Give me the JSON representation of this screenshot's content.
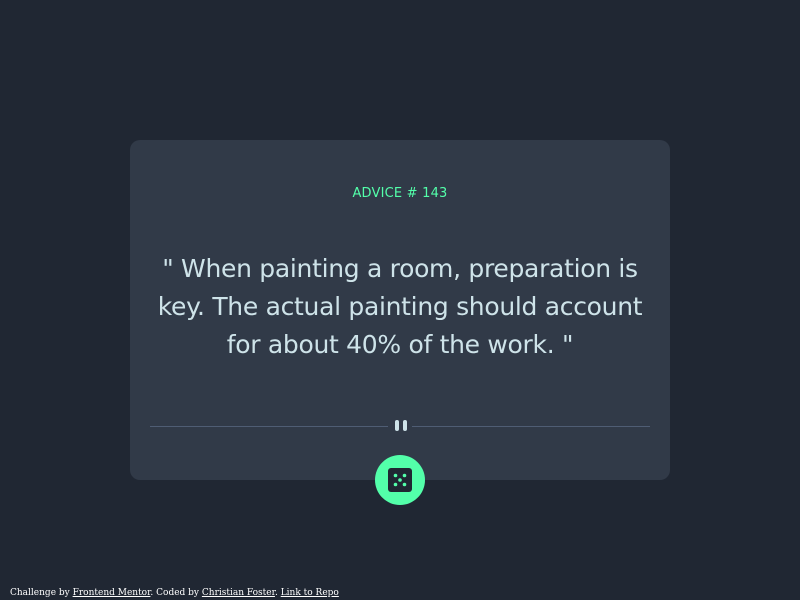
{
  "card": {
    "advice_label": "ADVICE # 143",
    "quote": "\" When painting a room, preparation is key. The actual painting should account for about 40% of the work. \"",
    "divider_icon": "pause-icon",
    "button_icon": "dice-icon"
  },
  "footer": {
    "challenge_prefix": "Challenge by",
    "frontend_mentor": "Frontend Mentor",
    "coded_by_prefix": ". Coded by",
    "author": "Christian Foster",
    "separator": ".",
    "repo_link": "Link to Repo"
  },
  "colors": {
    "page_background": "#202733",
    "card_background": "#313a48",
    "accent": "#53ffaa",
    "quote_text": "#cee3e9",
    "divider": "#4f5d74"
  }
}
